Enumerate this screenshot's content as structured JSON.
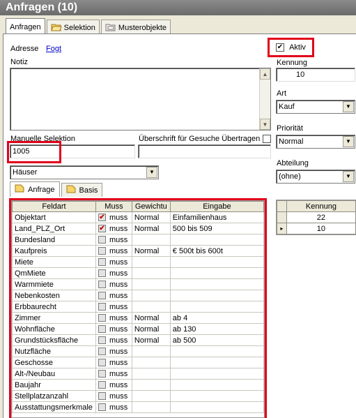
{
  "window": {
    "title": "Anfragen (10)"
  },
  "tabs": [
    {
      "label": "Anfragen",
      "icon": ""
    },
    {
      "label": "Selektion",
      "icon": "folder-open-icon"
    },
    {
      "label": "Musterobjekte",
      "icon": "folder-icon"
    }
  ],
  "form": {
    "adresse_label": "Adresse",
    "adresse_link": "Fogt",
    "notiz_label": "Notiz",
    "aktiv_label": "Aktiv",
    "aktiv_checked": true,
    "kennung_label": "Kennung",
    "kennung_value": "10",
    "art_label": "Art",
    "art_value": "Kauf",
    "prioritaet_label": "Priorität",
    "prioritaet_value": "Normal",
    "abteilung_label": "Abteilung",
    "abteilung_value": "(ohne)",
    "manuelle_selektion_label": "Manuelle Selektion",
    "manuelle_selektion_value": "1005",
    "ueberschrift_label": "Überschrift für Gesuche Übertragen",
    "ueberschrift_value": "",
    "objekttyp_value": "Häuser"
  },
  "inner_tabs": [
    {
      "label": "Anfrage",
      "icon": "folder-icon"
    },
    {
      "label": "Basis",
      "icon": "folder-icon"
    }
  ],
  "grid": {
    "columns": [
      "Feldart",
      "Muss",
      "Gewichtu",
      "Eingabe"
    ],
    "rows": [
      {
        "feldart": "Objektart",
        "checked": true,
        "muss": "muss",
        "gewichtung": "Normal",
        "eingabe": "Einfamilienhaus"
      },
      {
        "feldart": "Land_PLZ_Ort",
        "checked": true,
        "muss": "muss",
        "gewichtung": "Normal",
        "eingabe": "500 bis 509"
      },
      {
        "feldart": "Bundesland",
        "checked": false,
        "muss": "muss",
        "gewichtung": "",
        "eingabe": ""
      },
      {
        "feldart": "Kaufpreis",
        "checked": false,
        "muss": "muss",
        "gewichtung": "Normal",
        "eingabe": "€ 500t bis 600t"
      },
      {
        "feldart": "Miete",
        "checked": false,
        "muss": "muss",
        "gewichtung": "",
        "eingabe": ""
      },
      {
        "feldart": "QmMiete",
        "checked": false,
        "muss": "muss",
        "gewichtung": "",
        "eingabe": ""
      },
      {
        "feldart": "Warmmiete",
        "checked": false,
        "muss": "muss",
        "gewichtung": "",
        "eingabe": ""
      },
      {
        "feldart": "Nebenkosten",
        "checked": false,
        "muss": "muss",
        "gewichtung": "",
        "eingabe": ""
      },
      {
        "feldart": "Erbbaurecht",
        "checked": false,
        "muss": "muss",
        "gewichtung": "",
        "eingabe": ""
      },
      {
        "feldart": "Zimmer",
        "checked": false,
        "muss": "muss",
        "gewichtung": "Normal",
        "eingabe": "ab 4"
      },
      {
        "feldart": "Wohnfläche",
        "checked": false,
        "muss": "muss",
        "gewichtung": "Normal",
        "eingabe": "ab 130"
      },
      {
        "feldart": "Grundstücksfläche",
        "checked": false,
        "muss": "muss",
        "gewichtung": "Normal",
        "eingabe": "ab 500"
      },
      {
        "feldart": "Nutzfläche",
        "checked": false,
        "muss": "muss",
        "gewichtung": "",
        "eingabe": ""
      },
      {
        "feldart": "Geschosse",
        "checked": false,
        "muss": "muss",
        "gewichtung": "",
        "eingabe": ""
      },
      {
        "feldart": "Alt-/Neubau",
        "checked": false,
        "muss": "muss",
        "gewichtung": "",
        "eingabe": ""
      },
      {
        "feldart": "Baujahr",
        "checked": false,
        "muss": "muss",
        "gewichtung": "",
        "eingabe": ""
      },
      {
        "feldart": "Stellplatzanzahl",
        "checked": false,
        "muss": "muss",
        "gewichtung": "",
        "eingabe": ""
      },
      {
        "feldart": "Ausstattungsmerkmale",
        "checked": false,
        "muss": "muss",
        "gewichtung": "",
        "eingabe": ""
      }
    ]
  },
  "kennung_grid": {
    "column": "Kennung",
    "rows": [
      "22",
      "10"
    ]
  },
  "colors": {
    "highlight": "#e2001a",
    "titlebar": "#7a7a7a"
  }
}
